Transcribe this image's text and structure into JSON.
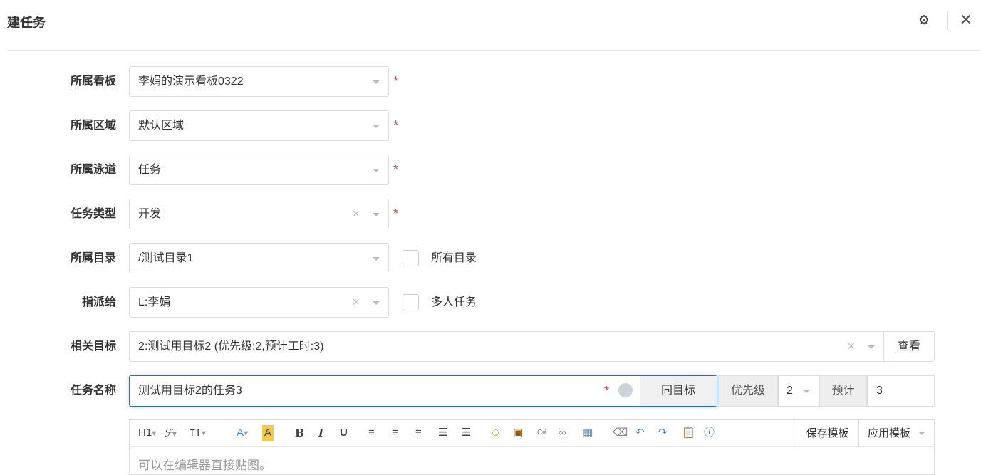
{
  "header": {
    "title": "建任务",
    "settings_icon": "gear-icon",
    "close_icon": "close-icon"
  },
  "form": {
    "board": {
      "label": "所属看板",
      "value": "李娟的演示看板0322"
    },
    "area": {
      "label": "所属区域",
      "value": "默认区域"
    },
    "lane": {
      "label": "所属泳道",
      "value": "任务"
    },
    "type": {
      "label": "任务类型",
      "value": "开发"
    },
    "dir": {
      "label": "所属目录",
      "value": "/测试目录1",
      "checkbox": "所有目录"
    },
    "assign": {
      "label": "指派给",
      "value": "L:李娟",
      "checkbox": "多人任务"
    },
    "goal": {
      "label": "相关目标",
      "value": "2:测试用目标2 (优先级:2,预计工时:3)",
      "view": "查看"
    },
    "name": {
      "label": "任务名称",
      "value": "测试用目标2的任务3",
      "same_goal": "同目标",
      "priority_label": "优先级",
      "priority": "2",
      "estimate_label": "预计",
      "estimate": "3"
    },
    "required": "*"
  },
  "editor": {
    "h1": "H1",
    "placeholder": "可以在编辑器直接贴图。",
    "save_template": "保存模板",
    "apply_template": "应用模板"
  },
  "colors": {
    "accent": "#1e6fe8",
    "required": "#e64340"
  }
}
